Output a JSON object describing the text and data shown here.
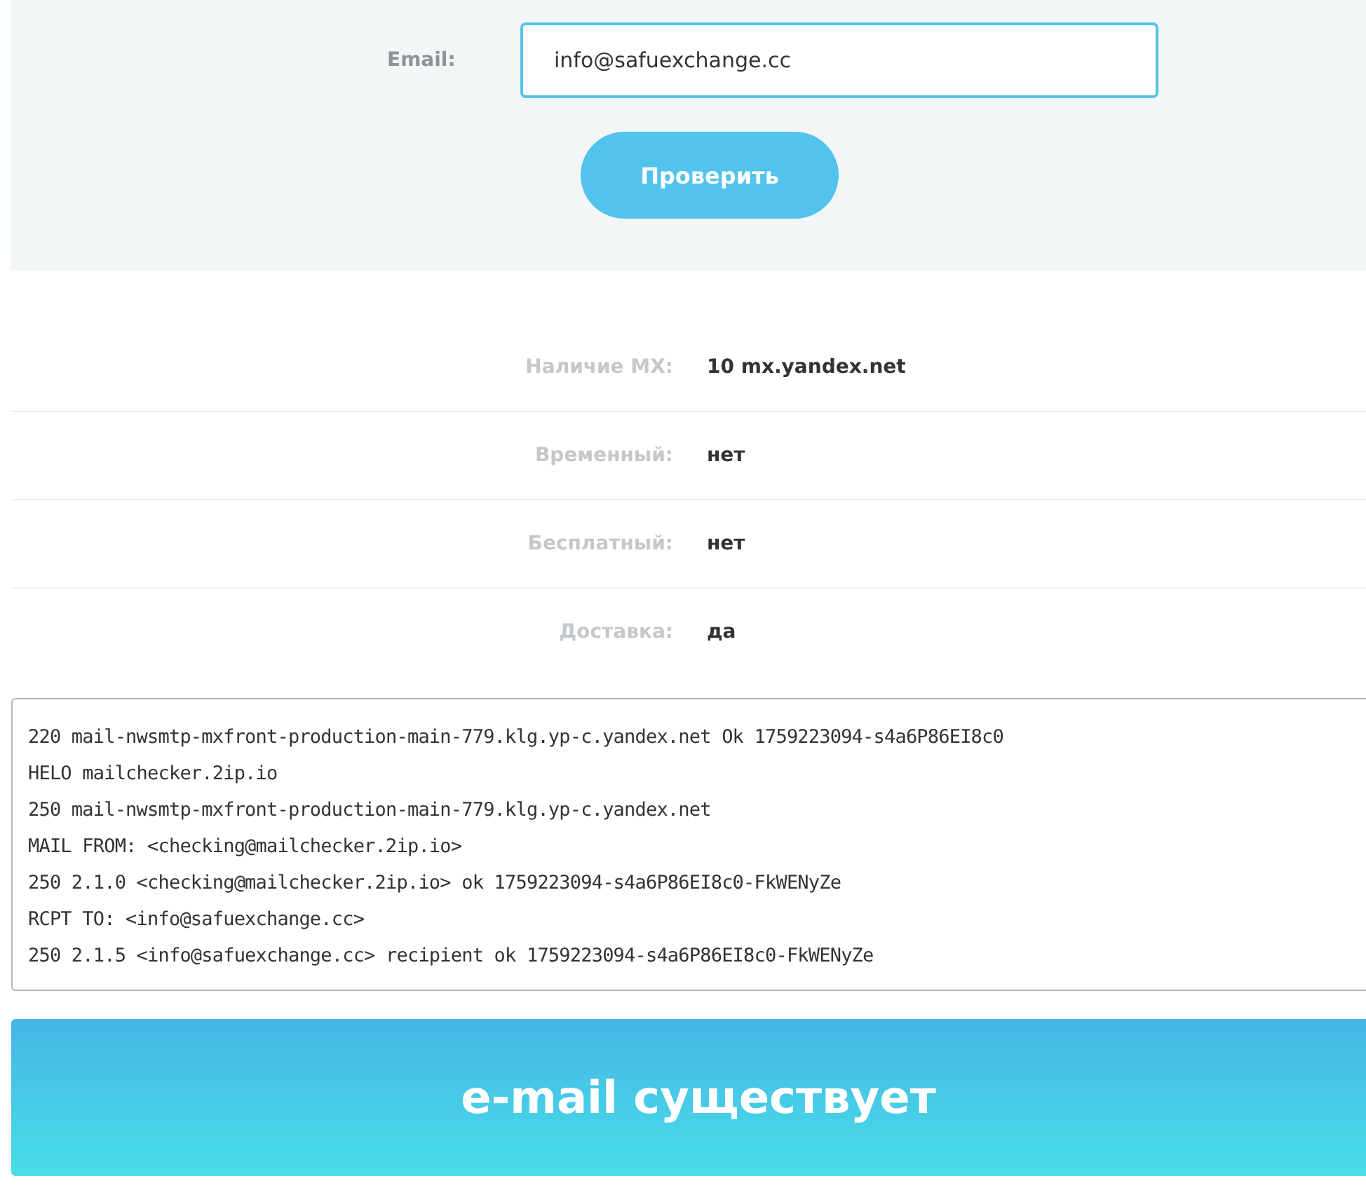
{
  "form": {
    "label": "Email:",
    "value": "info@safuexchange.cc",
    "button": "Проверить"
  },
  "results": [
    {
      "label": "Наличие MX:",
      "value": "10 mx.yandex.net"
    },
    {
      "label": "Временный:",
      "value": "нет"
    },
    {
      "label": "Бесплатный:",
      "value": "нет"
    },
    {
      "label": "Доставка:",
      "value": "да"
    }
  ],
  "log": [
    "220 mail-nwsmtp-mxfront-production-main-779.klg.yp-c.yandex.net Ok 1759223094-s4a6P86EI8c0",
    "HELO mailchecker.2ip.io",
    "250 mail-nwsmtp-mxfront-production-main-779.klg.yp-c.yandex.net",
    "MAIL FROM: <checking@mailchecker.2ip.io>",
    "250 2.1.0 <checking@mailchecker.2ip.io> ok 1759223094-s4a6P86EI8c0-FkWENyZe",
    "RCPT TO: <info@safuexchange.cc>",
    "250 2.1.5 <info@safuexchange.cc> recipient ok 1759223094-s4a6P86EI8c0-FkWENyZe"
  ],
  "verdict": "e-mail существует"
}
